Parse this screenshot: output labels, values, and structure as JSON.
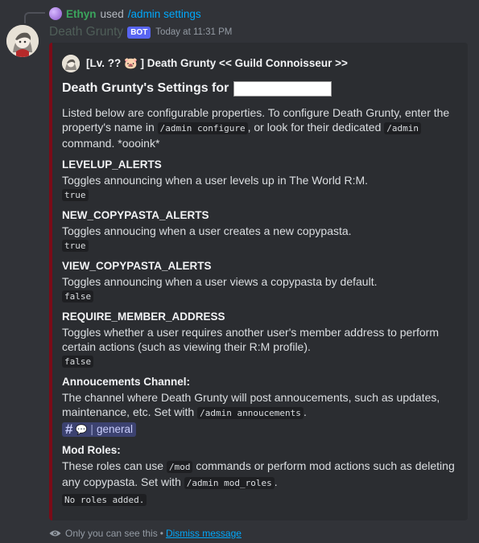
{
  "reply": {
    "username": "Ethyn",
    "used_text": "used",
    "command": "/admin settings"
  },
  "message": {
    "author": "Death Grunty",
    "bot_tag": "BOT",
    "timestamp": "Today at 11:31 PM"
  },
  "embed": {
    "color": "#7a0b17",
    "author_line": "[Lv. ?? 🐷 ] Death Grunty << Guild Connoisseur >>",
    "title": "Death Grunty's Settings for",
    "description": {
      "part1": "Listed below are configurable properties. To configure Death Grunty, enter the property's name in ",
      "code1": "/admin configure",
      "part2": ", or look for their dedicated ",
      "code2": "/admin",
      "part3": " command. *oooink*"
    },
    "fields": [
      {
        "name": "LEVELUP_ALERTS",
        "text": "Toggles announcing when a user levels up in The World R:M.",
        "value": "true"
      },
      {
        "name": "NEW_COPYPASTA_ALERTS",
        "text": "Toggles annoucing when a user creates a new copypasta.",
        "value": "true"
      },
      {
        "name": "VIEW_COPYPASTA_ALERTS",
        "text": "Toggles announcing when a user views a copypasta by default.",
        "value": "false"
      },
      {
        "name": "REQUIRE_MEMBER_ADDRESS",
        "text": "Toggles whether a user requires another user's member address to perform certain actions (such as viewing their R:M profile).",
        "value": "false"
      }
    ],
    "announcements": {
      "name": "Annoucements Channel:",
      "text": "The channel where Death Grunty will post annoucements, such as updates, maintenance, etc. Set with ",
      "code": "/admin annoucements",
      "suffix": ".",
      "channel": "general"
    },
    "mod_roles": {
      "name": "Mod Roles:",
      "text1": "These roles can use ",
      "code1": "/mod",
      "text2": " commands or perform mod actions such as deleting any copypasta. Set with ",
      "code2": "/admin mod_roles",
      "suffix": ".",
      "value": "No roles added."
    }
  },
  "footer": {
    "only_you": "Only you can see this",
    "separator": "•",
    "dismiss": "Dismiss message"
  },
  "icons": {
    "eye": "eye-icon",
    "channel": "hash-channel-icon"
  }
}
